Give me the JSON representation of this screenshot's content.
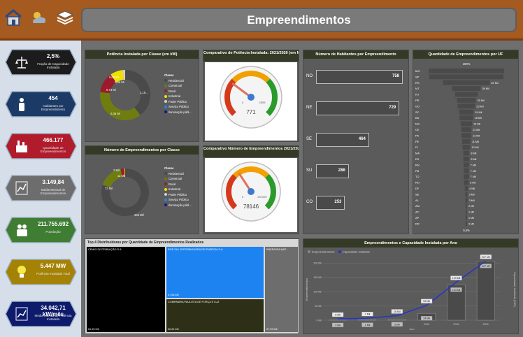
{
  "title": "Empreendimentos",
  "colors": {
    "topbar": "#a55a1f",
    "panel": "#5b5b5b",
    "header": "#353a26",
    "residencial": "#4a4a4a",
    "comercial": "#6f7d10",
    "rural": "#9a1c2c",
    "industrial": "#f0e000",
    "servico": "#1e88e5",
    "iluminacao": "#16188a",
    "poder": "#d0d0d0"
  },
  "kpis": [
    {
      "value": "2,5%",
      "label": "Fração de Capacidade Instalada",
      "color": "#1c1c1c",
      "icon": "scale-icon"
    },
    {
      "value": "454",
      "label": "Habitantes por Empreendimento",
      "color": "#1c3a66",
      "icon": "person-icon"
    },
    {
      "value": "466.177",
      "label": "Quantidade de Empreendimentos",
      "color": "#b01c2c",
      "icon": "plant-icon"
    },
    {
      "value": "3.149,84",
      "label": "Média Mensal de Empreendimentos",
      "color": "#6d6d6d",
      "icon": "chart-icon"
    },
    {
      "value": "211.755.692",
      "label": "População",
      "color": "#3e7d32",
      "icon": "people-icon"
    },
    {
      "value": "5.447 MW",
      "label": "Potência Instalada Total",
      "color": "#a48206",
      "icon": "bulb-icon"
    },
    {
      "value": "34.042,71 kW/mês",
      "label": "Média Mensal de Potência Instalada",
      "color": "#0e1a6b",
      "icon": "chart-trend-icon"
    }
  ],
  "panels": {
    "pot_classe": "Potência Instalada por Classe (em kW)",
    "comp_pot": "Comparativo de Potência Instalada: 2021/2020 (em MW)",
    "habitantes": "Número de Habitantes por Empreendimento",
    "qtd_uf": "Quantidade de Empreendimentos por UF",
    "num_classe": "Número de Empreendimentos por Classe",
    "comp_num": "Comparativo Número de Empreendimentos 2021/2020",
    "top_dist": "Top 4 Distribuidoras por Quantidade de Empreendimentos Realizados",
    "emp_cap": "Empreendimentos e Capacidade Instalada por Ano"
  },
  "legend": {
    "title": "Classe",
    "items": [
      "Residencial",
      "Comercial",
      "Rural",
      "Industrial",
      "Poder Público",
      "Serviço Público",
      "Iluminação públ..."
    ]
  },
  "chart_data": [
    {
      "type": "pie",
      "title": "Potência Instalada por Classe (em kW)",
      "labels": [
        "Residencial",
        "Comercial",
        "Rural",
        "Industrial",
        "Poder Público"
      ],
      "value_labels": [
        "2,19...",
        "2,05 Mi",
        "0,73 Mi",
        "0,46 Mi",
        "0,08 Mi"
      ],
      "values": [
        2.19,
        2.05,
        0.73,
        0.46,
        0.08
      ]
    },
    {
      "type": "gauge",
      "title": "Comparativo de Potência Instalada: 2021/2020 (em MW)",
      "value": 771,
      "min": "0",
      "max": "2553",
      "target": 2553
    },
    {
      "type": "bar",
      "title": "Número de Habitantes por Empreendimento",
      "categories": [
        "NO",
        "NE",
        "SE",
        "SU",
        "CO"
      ],
      "values": [
        758,
        729,
        464,
        286,
        253
      ]
    },
    {
      "type": "bar",
      "title": "Quantidade de Empreendimentos por UF",
      "top_label": "100%",
      "bottom_label": "0,4%",
      "categories": [
        "MG",
        "SP",
        "RS",
        "MT",
        "RJ",
        "PR",
        "GO",
        "SC",
        "BA",
        "MS",
        "CE",
        "PA",
        "PE",
        "PI",
        "MA",
        "ES",
        "RN",
        "PB",
        "TO",
        "RO",
        "DF",
        "SE",
        "AL",
        "AM",
        "AC",
        "AP",
        "RR"
      ],
      "value_labels": [
        "",
        "",
        "62 Mil",
        "38 Mil",
        "",
        "25 Mil",
        "23 Mil",
        "19 Mil",
        "18 Mil",
        "15 Mil",
        "13 Mil",
        "13 Mil",
        "11 Mil",
        "10 Mil",
        "8 Mil",
        "8 Mil",
        "7 Mil",
        "7 Mil",
        "7 Mil",
        "6 Mil",
        "4 Mil",
        "3 Mil",
        "3 Mil",
        "2 Mil",
        "1 Mil",
        "0 Mil",
        "0 Mil"
      ],
      "values": [
        100,
        98,
        62,
        38,
        30,
        25,
        23,
        19,
        18,
        15,
        13,
        13,
        11,
        10,
        8,
        8,
        7,
        7,
        7,
        6,
        4,
        3,
        3,
        2,
        1,
        0.5,
        0.4
      ]
    },
    {
      "type": "pie",
      "title": "Número de Empreendimentos por Classe",
      "value_labels": [
        "345 Mil",
        "73 Mil",
        "11 Mil",
        "2 Mil"
      ],
      "values": [
        345,
        73,
        11,
        2
      ]
    },
    {
      "type": "gauge",
      "title": "Comparativo Número de Empreendimentos 2021/2020",
      "value": 78146,
      "min": "0",
      "max": "207229",
      "target": 207229
    },
    {
      "type": "table",
      "title": "Top 4 Distribuidoras por Quantidade de Empreendimentos Realizados",
      "items": [
        {
          "name": "CEMIG DISTRIBUIÇÃO S.A",
          "value": "61,25 Mil"
        },
        {
          "name": "RGE SUL DISTRIBUIDORA DE ENERGIA S.A.",
          "value": "47,55 Mil"
        },
        {
          "name": "COMPANHIA PAULISTA DE FORÇA E LUZ",
          "value": "32,21 Mil"
        },
        {
          "name": "ENERGISA MAT...",
          "value": "27,99 Mil"
        }
      ]
    },
    {
      "type": "bar",
      "title": "Empreendimentos e Capacidade Instalada por Ano",
      "legend": [
        "Empreendimentos",
        "Capacidade Instalada"
      ],
      "xlabel": "Ano",
      "ylabel": "Empreendimentos",
      "y2label": "Capacidade Instalada (MW)",
      "yticks": [
        "0 Mil",
        "50 Mil",
        "100 Mil",
        "150 Mil",
        "200 Mil"
      ],
      "categories": [
        "2016",
        "2017",
        "2018",
        "2019",
        "2020",
        "2021"
      ],
      "bar_labels": [
        "0 Mil",
        "1 Mil",
        "3 Mil",
        "24 Mil",
        "124 Mil",
        "207 Mil"
      ],
      "line_labels": [
        "5 Mil",
        "7 Mil",
        "16 Mil",
        "52 Mil",
        "133 Mil",
        "207 Mil"
      ],
      "values": [
        0.4,
        1,
        3,
        24,
        124,
        207
      ],
      "line": [
        5,
        7,
        16,
        52,
        133,
        207
      ]
    }
  ]
}
